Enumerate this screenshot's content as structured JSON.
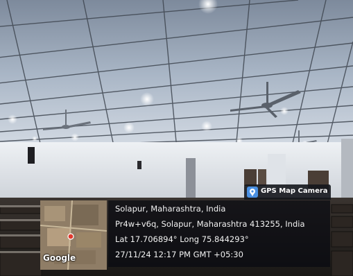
{
  "badge": {
    "label": "GPS Map Camera",
    "icon": "location-pin-icon"
  },
  "map": {
    "provider_logo": "Google"
  },
  "location": {
    "place": "Solapur, Maharashtra, India",
    "address": "Pr4w+v6q, Solapur, Maharashtra 413255, India",
    "coordinates": "Lat 17.706894° Long 75.844293°",
    "timestamp": "27/11/24 12:17 PM GMT +05:30"
  }
}
